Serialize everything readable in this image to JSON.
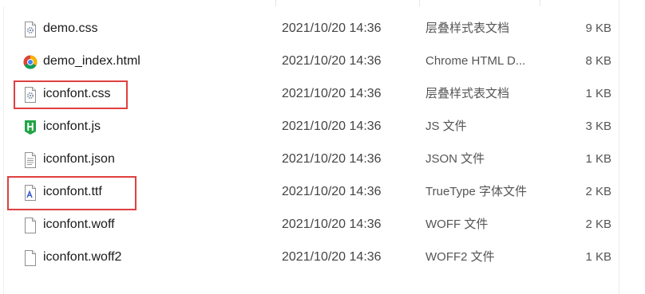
{
  "accent": {
    "highlight_color": "#e13f3f"
  },
  "files": [
    {
      "name": "demo.css",
      "modified": "2021/10/20 14:36",
      "type": "层叠样式表文档",
      "size": "9 KB",
      "icon": "css-file-icon"
    },
    {
      "name": "demo_index.html",
      "modified": "2021/10/20 14:36",
      "type": "Chrome HTML D...",
      "size": "8 KB",
      "icon": "chrome-html-icon"
    },
    {
      "name": "iconfont.css",
      "modified": "2021/10/20 14:36",
      "type": "层叠样式表文档",
      "size": "1 KB",
      "icon": "css-file-icon",
      "highlighted": true
    },
    {
      "name": "iconfont.js",
      "modified": "2021/10/20 14:36",
      "type": "JS 文件",
      "size": "3 KB",
      "icon": "js-file-icon"
    },
    {
      "name": "iconfont.json",
      "modified": "2021/10/20 14:36",
      "type": "JSON 文件",
      "size": "1 KB",
      "icon": "text-file-icon"
    },
    {
      "name": "iconfont.ttf",
      "modified": "2021/10/20 14:36",
      "type": "TrueType 字体文件",
      "size": "2 KB",
      "icon": "font-file-icon",
      "highlighted": true
    },
    {
      "name": "iconfont.woff",
      "modified": "2021/10/20 14:36",
      "type": "WOFF 文件",
      "size": "2 KB",
      "icon": "blank-file-icon"
    },
    {
      "name": "iconfont.woff2",
      "modified": "2021/10/20 14:36",
      "type": "WOFF2 文件",
      "size": "1 KB",
      "icon": "blank-file-icon"
    }
  ]
}
